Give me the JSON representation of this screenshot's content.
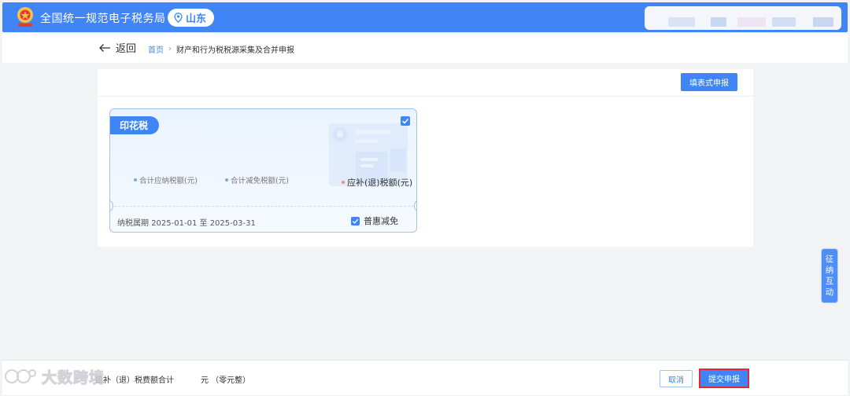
{
  "header": {
    "title": "全国统一规范电子税务局",
    "region": "山东",
    "logo_icon": "tax-emblem-icon",
    "pin_icon": "location-pin-icon",
    "brand_color": "#3f85f5"
  },
  "nav": {
    "back_label": "返回",
    "breadcrumb": {
      "home": "首页",
      "separator": "›",
      "current": "财产和行为税税源采集及合并申报"
    }
  },
  "toolbar": {
    "fill_form_label": "填表式申报"
  },
  "tax_card": {
    "tag": "印花税",
    "selected": true,
    "metrics": [
      {
        "label": "合计应纳税额(元)"
      },
      {
        "label": "合计减免税额(元)"
      },
      {
        "label": "应补(退)税额(元)"
      }
    ],
    "period_label": "纳税属期",
    "period_start": "2025-01-01",
    "period_to": "至",
    "period_end": "2025-03-31",
    "benefit_label": "普惠减免",
    "benefit_checked": true
  },
  "side_float": {
    "chars": [
      "征",
      "纳",
      "互",
      "动"
    ]
  },
  "footer": {
    "total_label": "应补（退）税费额合计",
    "total_unit": "元 （零元整）",
    "cancel_label": "取消",
    "submit_label": "提交申报",
    "watermark": "大数跨境"
  },
  "colors": {
    "accent": "#3f85f5",
    "highlight_border": "#e02b36"
  }
}
